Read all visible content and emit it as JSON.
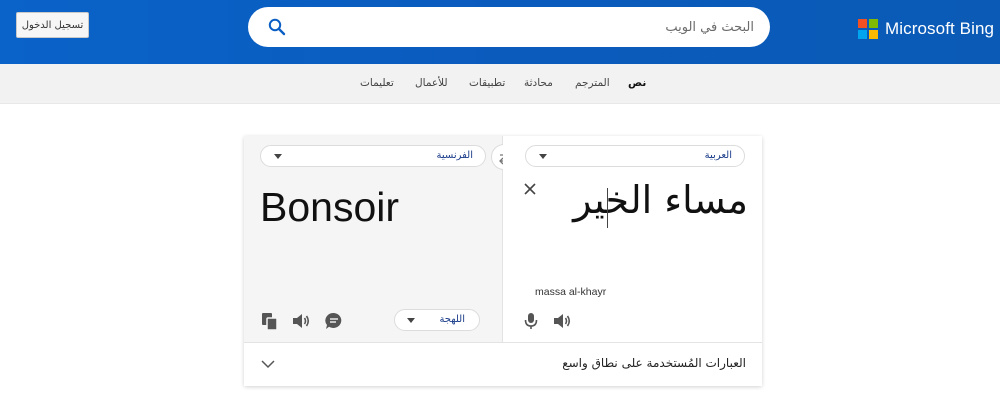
{
  "app": {
    "logo_text": "Microsoft Bing",
    "brand_colors": {
      "red": "#f25022",
      "green": "#7fba00",
      "blue": "#00a4ef",
      "yellow": "#ffb900",
      "header": "#0a5ec4"
    }
  },
  "header": {
    "search_placeholder": "البحث في الويب",
    "signin_label": "تسجيل الدخول",
    "search_icon": "search-icon"
  },
  "nav": {
    "items": [
      {
        "label": "نص",
        "active": true
      },
      {
        "label": "المترجم",
        "active": false
      },
      {
        "label": "محادثة",
        "active": false
      },
      {
        "label": "تطبيقات",
        "active": false
      },
      {
        "label": "للأعمال",
        "active": false
      },
      {
        "label": "تعليمات",
        "active": false
      }
    ]
  },
  "translator": {
    "source": {
      "language": "العربية",
      "text": "مساء الخير",
      "transliteration": "massa al-khayr"
    },
    "target": {
      "language": "الفرنسية",
      "text": "Bonsoir",
      "dialect": "اللهجة"
    },
    "swap_icon": "swap-arrows-icon",
    "bottom": {
      "phrases_label": "العبارات المُستخدمة على نطاق واسع"
    }
  }
}
